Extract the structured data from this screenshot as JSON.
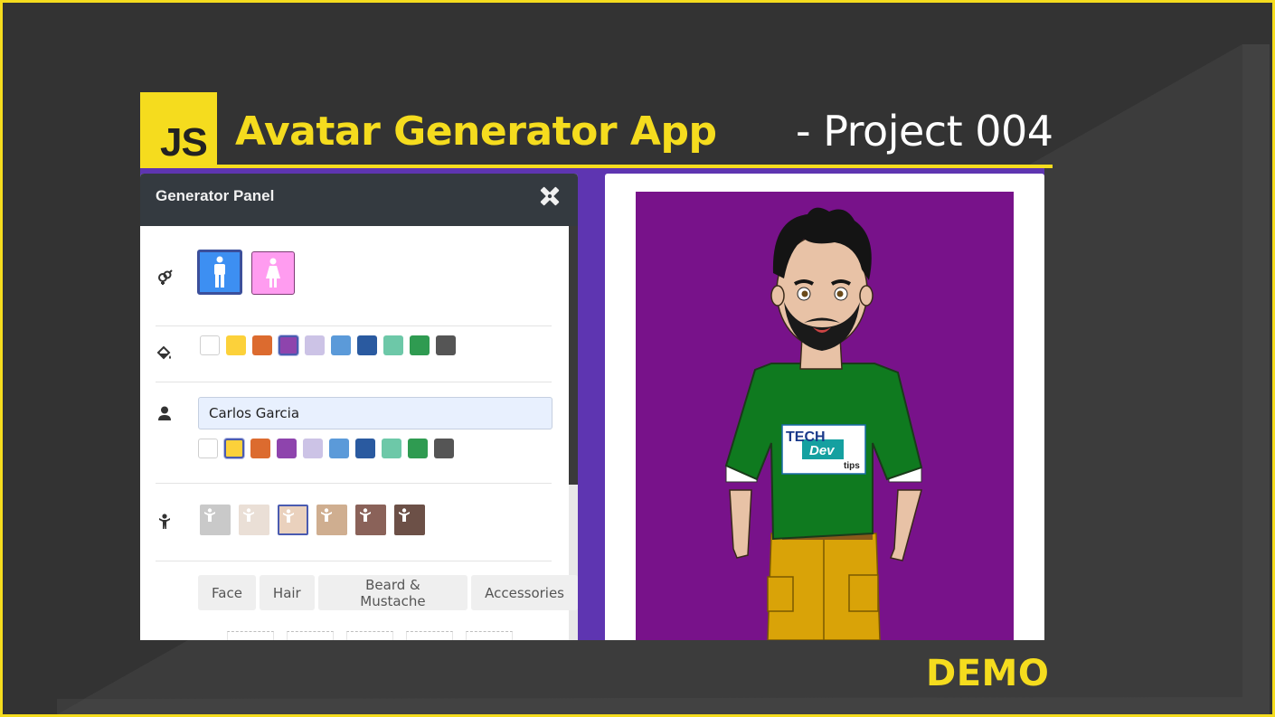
{
  "banner": {
    "logo_text": "JS",
    "title": "Avatar Generator App",
    "project": "- Project 004",
    "demo": "DEMO"
  },
  "panel": {
    "title": "Generator Panel",
    "tools_icon": "pencil-ruler-icon",
    "gender": {
      "icon": "gender-icon",
      "options": [
        {
          "name": "male",
          "icon": "male-icon",
          "selected": true
        },
        {
          "name": "female",
          "icon": "female-icon",
          "selected": false
        }
      ]
    },
    "background": {
      "icon": "paint-bucket-icon",
      "colors": [
        "#ffffff",
        "#fcd13a",
        "#dc6b2f",
        "#8e44ad",
        "#ccc3e6",
        "#5b9ad9",
        "#2a5aa0",
        "#6dc8a8",
        "#2f9b51",
        "#555555"
      ],
      "selected_index": 3
    },
    "name": {
      "icon": "user-icon",
      "value": "Carlos Garcia",
      "colors": [
        "#ffffff",
        "#fcd13a",
        "#dc6b2f",
        "#8e44ad",
        "#ccc3e6",
        "#5b9ad9",
        "#2a5aa0",
        "#6dc8a8",
        "#2f9b51",
        "#555555"
      ],
      "selected_index": 1
    },
    "skin": {
      "icon": "body-icon",
      "tones": [
        "#c9c9c9",
        "#eadfd6",
        "#ead1bd",
        "#cfae90",
        "#8a6259",
        "#6c5047"
      ],
      "selected_index": 2
    },
    "tabs": [
      "Face",
      "Hair",
      "Beard & Mustache",
      "Accessories"
    ]
  },
  "preview": {
    "background_color": "#78128a",
    "shirt_logo": {
      "line1": "TECH",
      "line2": "Dev",
      "line3": "tips"
    }
  },
  "colors": {
    "accent": "#f5dc1e",
    "frame": "#333333",
    "screen": "#5e35b1"
  }
}
